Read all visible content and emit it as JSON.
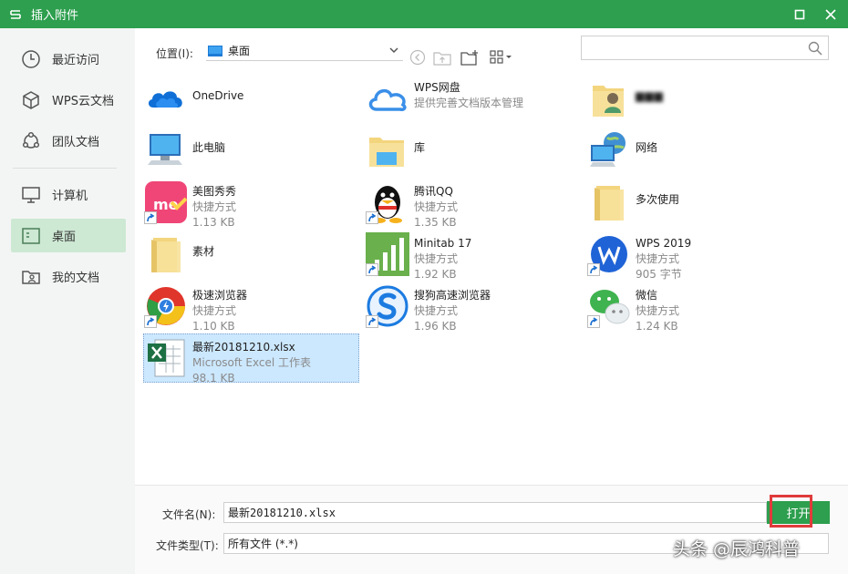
{
  "window": {
    "title": "插入附件"
  },
  "sidebar": {
    "items": [
      {
        "label": "最近访问",
        "icon": "clock-icon"
      },
      {
        "label": "WPS云文档",
        "icon": "cube-icon"
      },
      {
        "label": "团队文档",
        "icon": "team-icon"
      },
      {
        "label": "计算机",
        "icon": "monitor-icon"
      },
      {
        "label": "桌面",
        "icon": "desktop-icon",
        "active": true
      },
      {
        "label": "我的文档",
        "icon": "my-docs-icon"
      }
    ]
  },
  "toolbar": {
    "location_label": "位置(I):",
    "location_value": "桌面",
    "search_placeholder": ""
  },
  "files": [
    {
      "name": "OneDrive",
      "sub1": "",
      "sub2": "",
      "icon": "onedrive-icon"
    },
    {
      "name": "WPS网盘",
      "sub1": "提供完善文档版本管理",
      "sub2": "",
      "icon": "wps-cloud-icon"
    },
    {
      "name": "▆▆▆",
      "sub1": "",
      "sub2": "",
      "icon": "user-folder-icon",
      "blurred": true
    },
    {
      "name": "此电脑",
      "sub1": "",
      "sub2": "",
      "icon": "this-pc-icon"
    },
    {
      "name": "库",
      "sub1": "",
      "sub2": "",
      "icon": "library-icon"
    },
    {
      "name": "网络",
      "sub1": "",
      "sub2": "",
      "icon": "network-icon"
    },
    {
      "name": "美图秀秀",
      "sub1": "快捷方式",
      "sub2": "1.13 KB",
      "icon": "meitu-icon",
      "shortcut": true
    },
    {
      "name": "腾讯QQ",
      "sub1": "快捷方式",
      "sub2": "1.35 KB",
      "icon": "qq-icon",
      "shortcut": true
    },
    {
      "name": "多次使用",
      "sub1": "",
      "sub2": "",
      "icon": "folder-icon"
    },
    {
      "name": "素材",
      "sub1": "",
      "sub2": "",
      "icon": "folder-icon"
    },
    {
      "name": "Minitab 17",
      "sub1": "快捷方式",
      "sub2": "1.92 KB",
      "icon": "minitab-icon",
      "shortcut": true
    },
    {
      "name": "WPS 2019",
      "sub1": "快捷方式",
      "sub2": "905 字节",
      "icon": "wps-icon",
      "shortcut": true
    },
    {
      "name": "极速浏览器",
      "sub1": "快捷方式",
      "sub2": "1.10 KB",
      "icon": "chrome-icon",
      "shortcut": true
    },
    {
      "name": "搜狗高速浏览器",
      "sub1": "快捷方式",
      "sub2": "1.96 KB",
      "icon": "sogou-icon",
      "shortcut": true
    },
    {
      "name": "微信",
      "sub1": "快捷方式",
      "sub2": "1.24 KB",
      "icon": "wechat-icon",
      "shortcut": true
    },
    {
      "name": "最新20181210.xlsx",
      "sub1": "Microsoft Excel 工作表",
      "sub2": "98.1 KB",
      "icon": "excel-icon",
      "selected": true
    }
  ],
  "footer": {
    "filename_label": "文件名(N):",
    "filename_value": "最新20181210.xlsx",
    "filetype_label": "文件类型(T):",
    "filetype_value": "所有文件 (*.*)",
    "open_label": "打开"
  },
  "watermark": "头条 @辰鸿科普",
  "colors": {
    "brand": "#2d9f4e",
    "sidebar_bg": "#f3f5f4",
    "active_nav": "#cde8d3",
    "selection": "#cce8ff",
    "highlight_box": "#e03b3b"
  }
}
